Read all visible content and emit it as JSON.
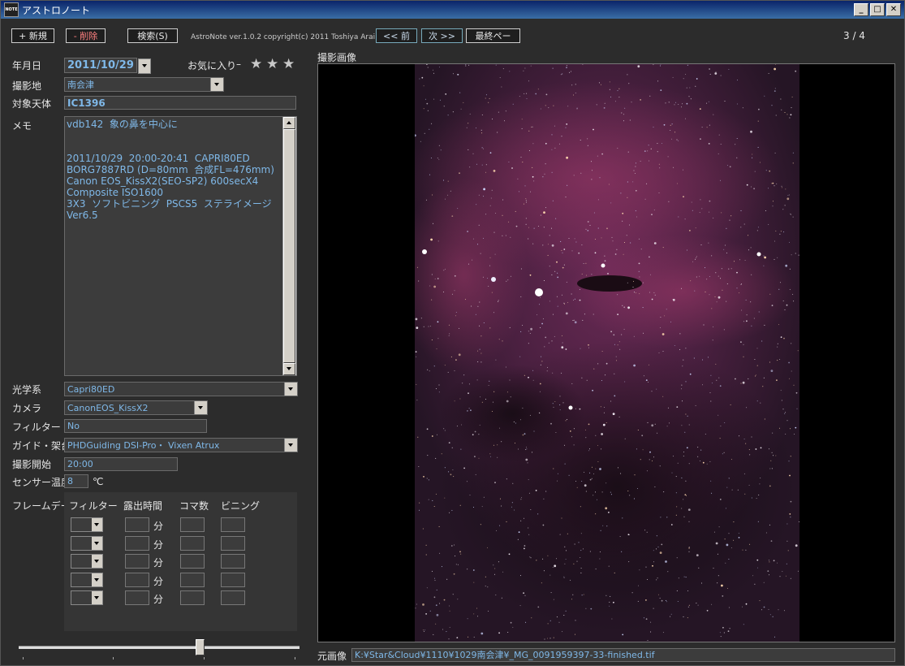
{
  "window": {
    "title": "アストロノート",
    "icon_text": "NOTE"
  },
  "toolbar": {
    "new_label": "+ 新規",
    "delete_label": "- 削除",
    "search_label": "検索(S)",
    "copyright": "AstroNote ver.1.0.2  copyright(c) 2011 Toshiya Arai",
    "prev_label": "<< 前",
    "next_label": "次 >>",
    "last_label": "最終ペー",
    "page_indicator": "3 / 4"
  },
  "form": {
    "date_label": "年月日",
    "date_value": "2011/10/29",
    "favorite_label": "お気に入り",
    "favorite_dash": "–",
    "favorite_stars": 0,
    "location_label": "撮影地",
    "location_value": "南会津",
    "object_label": "対象天体",
    "object_value": "IC1396",
    "memo_label": "メモ",
    "memo_value": "vdb142  象の鼻を中心に\n\n\n2011/10/29  20:00-20:41  CAPRI80ED\nBORG7887RD (D=80mm  合成FL=476mm)\nCanon EOS_KissX2(SEO-SP2) 600secX4\nComposite ISO1600\n3X3  ソフトビニング  PSCS5  ステライメージ\nVer6.5",
    "optics_label": "光学系",
    "optics_value": "Capri80ED",
    "camera_label": "カメラ",
    "camera_value": "CanonEOS_KissX2",
    "filter_label": "フィルター",
    "filter_value": "No",
    "guide_label": "ガイド・架台",
    "guide_value": "PHDGuiding DSI-Pro・ Vixen  Atrux",
    "start_label": "撮影開始",
    "start_value": "20:00",
    "sensor_label": "センサー温度",
    "sensor_value": "8",
    "sensor_unit": "℃"
  },
  "frame_data": {
    "label": "フレームデータ",
    "col_filter": "フィルター",
    "col_exposure": "露出時間",
    "col_count": "コマ数",
    "col_binning": "ビニング",
    "minute_unit": "分",
    "rows": 5
  },
  "image": {
    "section_label": "撮影画像",
    "source_label": "元画像",
    "source_path": "K:¥Star&Cloud¥1110¥1029南会津¥_MG_0091959397-33-finished.tif"
  },
  "slider": {
    "value": 0.65
  }
}
